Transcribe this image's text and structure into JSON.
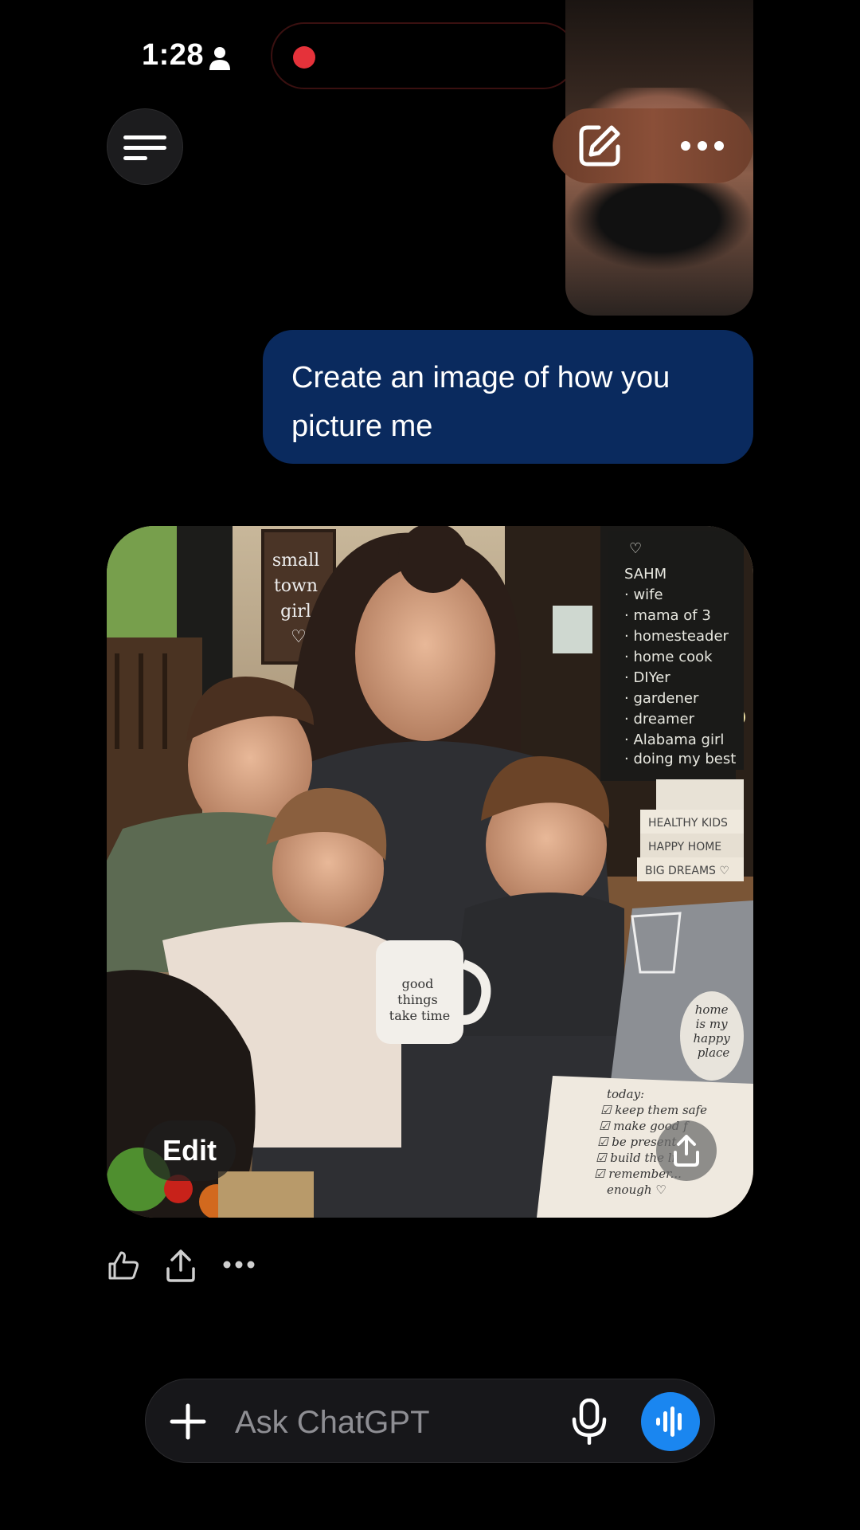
{
  "status_bar": {
    "time": "1:28"
  },
  "chat": {
    "user_message": "Create an image of how you picture me",
    "image": {
      "edit_label": "Edit",
      "sign_text": [
        "small",
        "town",
        "girl"
      ],
      "chalkboard_lines": [
        "SAHM",
        "· wife",
        "· mama of 3",
        "· homesteader",
        "· home cook",
        "· DIYer",
        "· gardener",
        "· dreamer",
        "· Alabama girl",
        "· doing my best"
      ],
      "books": [
        "HEALTHY KIDS",
        "HAPPY HOME",
        "BIG DREAMS ♡"
      ],
      "mug_text": [
        "good",
        "things",
        "take time"
      ],
      "sticker_text": [
        "home",
        "is my",
        "happy",
        "place"
      ],
      "notebook_lines": [
        "today:",
        "☑ keep them safe",
        "☑ make good f",
        "☑ be present",
        "☑ build the li",
        "☑ remember...",
        "enough ♡"
      ]
    }
  },
  "composer": {
    "placeholder": "Ask ChatGPT"
  },
  "colors": {
    "user_bubble": "#0a2a5e",
    "voice_button": "#1a86f0",
    "recording_dot": "#e5323a"
  },
  "icons": [
    "person-icon",
    "signal-icon",
    "wifi-icon",
    "battery-icon",
    "menu-icon",
    "edit-icon",
    "more-icon",
    "thumbs-icon",
    "share-icon",
    "plus-icon",
    "mic-icon",
    "voice-waveform-icon"
  ]
}
